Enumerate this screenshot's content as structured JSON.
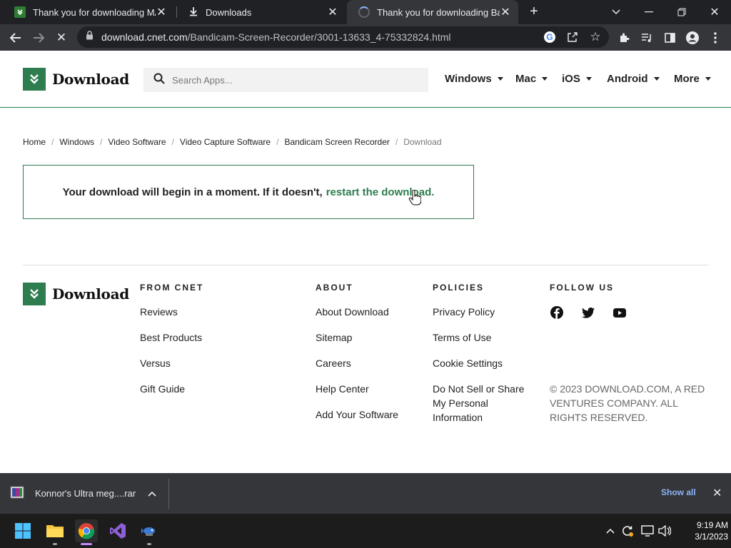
{
  "browser": {
    "tabs": [
      {
        "title": "Thank you for downloading MAS",
        "icon": "download-site-favicon"
      },
      {
        "title": "Downloads",
        "icon": "download-arrow-icon"
      },
      {
        "title": "Thank you for downloading Band",
        "icon": "loading-spinner"
      }
    ],
    "url_host": "download.cnet.com",
    "url_path": "/Bandicam-Screen-Recorder/3001-13633_4-75332824.html"
  },
  "site": {
    "logo_text": "Download",
    "search_placeholder": "Search Apps...",
    "nav": [
      "Windows",
      "Mac",
      "iOS",
      "Android",
      "More"
    ]
  },
  "breadcrumb": [
    "Home",
    "Windows",
    "Video Software",
    "Video Capture Software",
    "Bandicam Screen Recorder",
    "Download"
  ],
  "notice": {
    "text": "Your download will begin in a moment. If it doesn't,",
    "link": "restart the download."
  },
  "footer": {
    "logo_text": "Download",
    "from_cnet": {
      "heading": "FROM CNET",
      "links": [
        "Reviews",
        "Best Products",
        "Versus",
        "Gift Guide"
      ]
    },
    "about": {
      "heading": "ABOUT",
      "links": [
        "About Download",
        "Sitemap",
        "Careers",
        "Help Center",
        "Add Your Software"
      ]
    },
    "policies": {
      "heading": "POLICIES",
      "links": [
        "Privacy Policy",
        "Terms of Use",
        "Cookie Settings",
        "Do Not Sell or Share My Personal Information"
      ]
    },
    "follow": {
      "heading": "FOLLOW US",
      "icons": [
        "facebook-icon",
        "twitter-icon",
        "youtube-icon"
      ]
    },
    "copyright": "© 2023 DOWNLOAD.COM, A RED VENTURES COMPANY. ALL RIGHTS RESERVED."
  },
  "download_shelf": {
    "file_name": "Konnor's Ultra meg....rar",
    "show_all": "Show all"
  },
  "taskbar": {
    "time": "9:19 AM",
    "date": "3/1/2023"
  },
  "colors": {
    "brand_green": "#2e7d4f",
    "chrome_dark": "#202124",
    "chrome_toolbar": "#35363a",
    "link_blue": "#8ab4f8"
  }
}
